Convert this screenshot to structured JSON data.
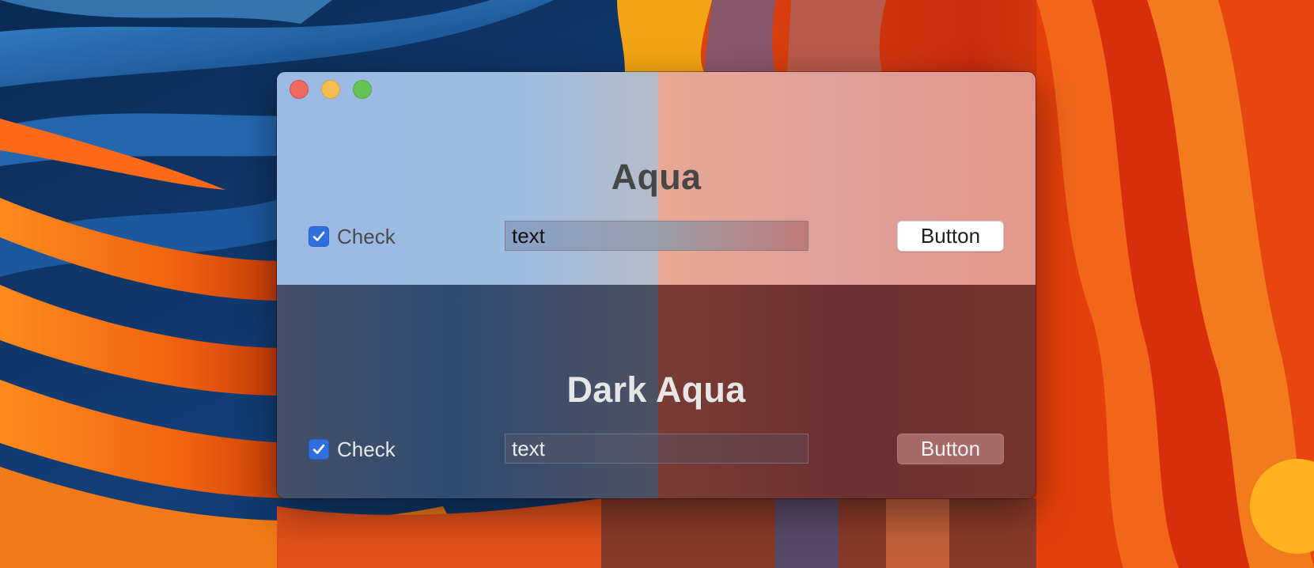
{
  "window": {
    "traffic_lights": [
      "close",
      "minimize",
      "zoom"
    ]
  },
  "light_section": {
    "heading": "Aqua",
    "checkbox": {
      "label": "Check",
      "checked": true
    },
    "text_field": {
      "value": "text"
    },
    "button": {
      "label": "Button"
    }
  },
  "dark_section": {
    "heading": "Dark Aqua",
    "checkbox": {
      "label": "Check",
      "checked": true
    },
    "text_field": {
      "value": "text"
    },
    "button": {
      "label": "Button"
    }
  },
  "colors": {
    "accent": "#2f6fe0",
    "close": "#ee6a5f",
    "minimize": "#f5be4f",
    "zoom": "#62c554"
  }
}
